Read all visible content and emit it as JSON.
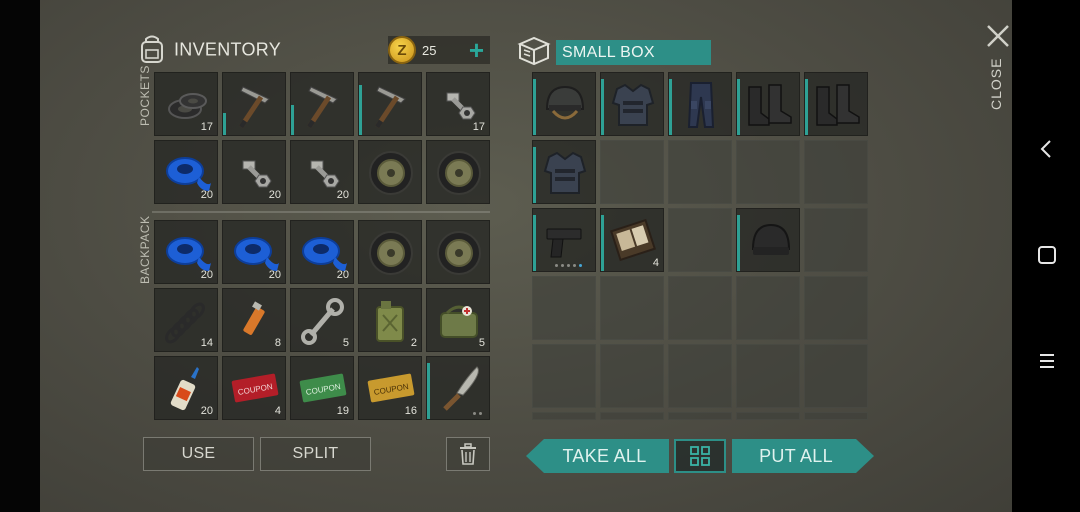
{
  "inventory": {
    "title": "INVENTORY",
    "coins": "25",
    "coin_symbol": "Z",
    "add_icon": "plus-icon",
    "pockets_label": "POCKETS",
    "backpack_label": "BACKPACK",
    "pockets": [
      {
        "name": "rubber-rings",
        "qty": "17"
      },
      {
        "name": "pickaxe",
        "qty": ""
      },
      {
        "name": "pickaxe",
        "qty": ""
      },
      {
        "name": "pickaxe",
        "qty": ""
      },
      {
        "name": "nuts-bolts",
        "qty": "17"
      },
      {
        "name": "blue-tape",
        "qty": "20"
      },
      {
        "name": "nuts-bolts",
        "qty": "20"
      },
      {
        "name": "nuts-bolts",
        "qty": "20"
      },
      {
        "name": "wheel",
        "qty": ""
      },
      {
        "name": "wheel",
        "qty": ""
      }
    ],
    "backpack": [
      {
        "name": "blue-tape",
        "qty": "20"
      },
      {
        "name": "blue-tape",
        "qty": "20"
      },
      {
        "name": "blue-tape",
        "qty": "20"
      },
      {
        "name": "wheel",
        "qty": ""
      },
      {
        "name": "wheel",
        "qty": ""
      },
      {
        "name": "spring",
        "qty": "14"
      },
      {
        "name": "lighter",
        "qty": "8"
      },
      {
        "name": "wrench",
        "qty": "5"
      },
      {
        "name": "jerrycan",
        "qty": "2"
      },
      {
        "name": "medkit-bag",
        "qty": "5"
      },
      {
        "name": "glue",
        "qty": "20"
      },
      {
        "name": "red-coupon",
        "qty": "4"
      },
      {
        "name": "green-coupon",
        "qty": "19"
      },
      {
        "name": "gold-coupon",
        "qty": "16"
      },
      {
        "name": "machete",
        "qty": ""
      }
    ],
    "coupon_labels": {
      "red": "COUPON",
      "green": "COUPON",
      "gold": "COUPON"
    },
    "use_label": "USE",
    "split_label": "SPLIT"
  },
  "box": {
    "title": "SMALL BOX",
    "items": [
      {
        "name": "helmet",
        "qty": ""
      },
      {
        "name": "body-armor",
        "qty": ""
      },
      {
        "name": "tactical-pants",
        "qty": ""
      },
      {
        "name": "boots",
        "qty": ""
      },
      {
        "name": "boots",
        "qty": ""
      },
      {
        "name": "body-armor",
        "qty": ""
      },
      {
        "name": "pistol",
        "qty": ""
      },
      {
        "name": "notebook",
        "qty": "4"
      },
      {
        "name": "beanie",
        "qty": ""
      }
    ],
    "take_all_label": "TAKE ALL",
    "put_all_label": "PUT ALL"
  },
  "close_label": "CLOSE",
  "colors": {
    "accent": "#2d8f87",
    "panel": "#4d4c43"
  }
}
